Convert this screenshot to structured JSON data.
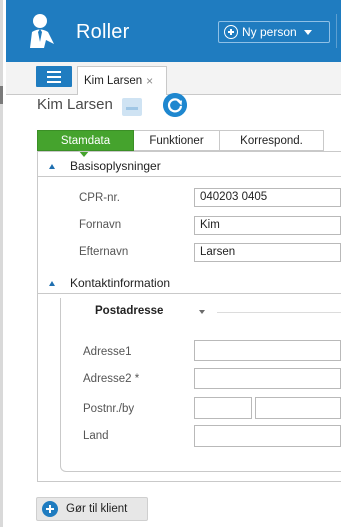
{
  "app": {
    "title": "Roller",
    "new_person_label": "Ny person",
    "logo_icon": "person-tie-icon"
  },
  "tabs": {
    "menu_icon": "hamburger-menu-icon",
    "open_tab_label": "Kim Larsen",
    "open_tab_close": "×"
  },
  "person": {
    "name": "Kim Larsen",
    "icons": [
      "person-card-icon",
      "refresh-icon"
    ]
  },
  "section_tabs": [
    {
      "label": "Stamdata",
      "active": true
    },
    {
      "label": "Funktioner",
      "active": false
    },
    {
      "label": "Korrespond.",
      "active": false
    }
  ],
  "basis": {
    "title": "Basisoplysninger",
    "fields": [
      {
        "label": "CPR-nr.",
        "value": "040203 0405"
      },
      {
        "label": "Fornavn",
        "value": "Kim"
      },
      {
        "label": "Efternavn",
        "value": "Larsen"
      }
    ]
  },
  "kontakt": {
    "title": "Kontaktinformation",
    "postadresse_title": "Postadresse",
    "fields": [
      {
        "label": "Adresse1",
        "value": ""
      },
      {
        "label": "Adresse2 *",
        "value": ""
      },
      {
        "label": "Postnr./by",
        "value": "",
        "city_value": ""
      },
      {
        "label": "Land",
        "value": ""
      }
    ]
  },
  "footer": {
    "client_button_label": "Gør til klient"
  },
  "colors": {
    "titlebar": "#1f7cc0",
    "active_tab": "#45a32d",
    "accent_blue": "#1f7cc0"
  }
}
